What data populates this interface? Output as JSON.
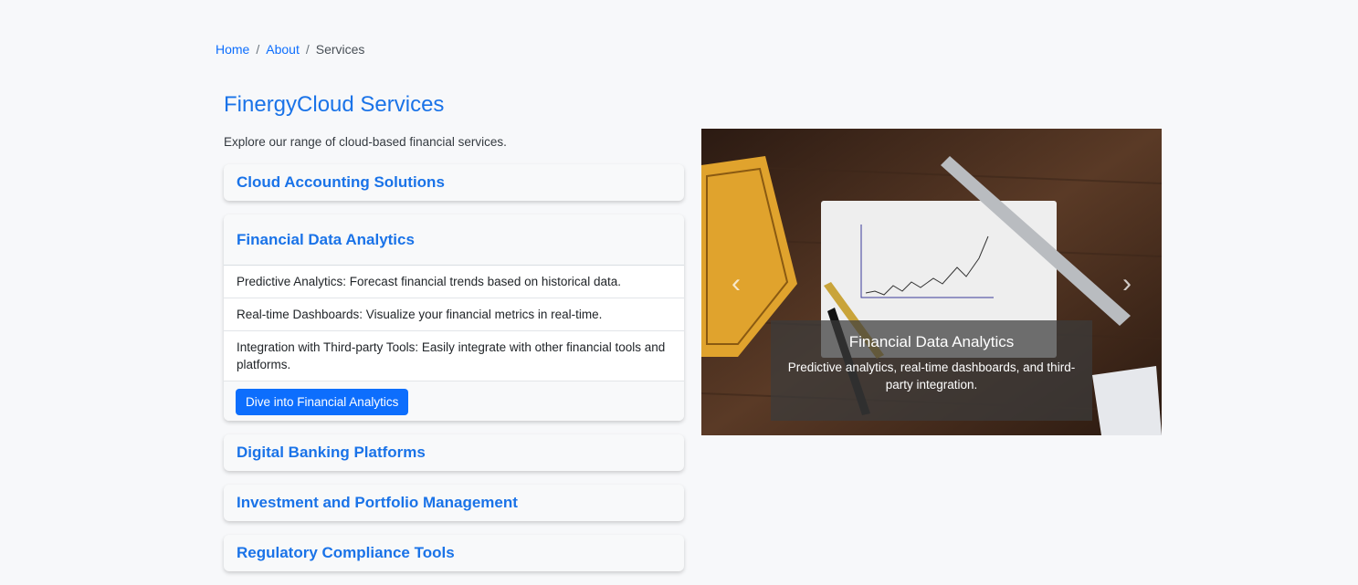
{
  "breadcrumb": {
    "home": "Home",
    "about": "About",
    "current": "Services",
    "separator": "/"
  },
  "page": {
    "title": "FinergyCloud Services",
    "description": "Explore our range of cloud-based financial services."
  },
  "accordion": {
    "items": [
      {
        "title": "Cloud Accounting Solutions"
      },
      {
        "title": "Financial Data Analytics",
        "features": [
          "Predictive Analytics: Forecast financial trends based on historical data.",
          "Real-time Dashboards: Visualize your financial metrics in real-time.",
          "Integration with Third-party Tools: Easily integrate with other financial tools and platforms."
        ],
        "button_label": "Dive into Financial Analytics"
      },
      {
        "title": "Digital Banking Platforms"
      },
      {
        "title": "Investment and Portfolio Management"
      },
      {
        "title": "Regulatory Compliance Tools"
      }
    ]
  },
  "carousel": {
    "caption_title": "Financial Data Analytics",
    "caption_text": "Predictive analytics, real-time dashboards, and third-party integration.",
    "prev_icon": "chevron-left-icon",
    "next_icon": "chevron-right-icon"
  },
  "colors": {
    "accent": "#1a73e8",
    "button": "#0d6efd",
    "background": "#f7f8fa"
  }
}
